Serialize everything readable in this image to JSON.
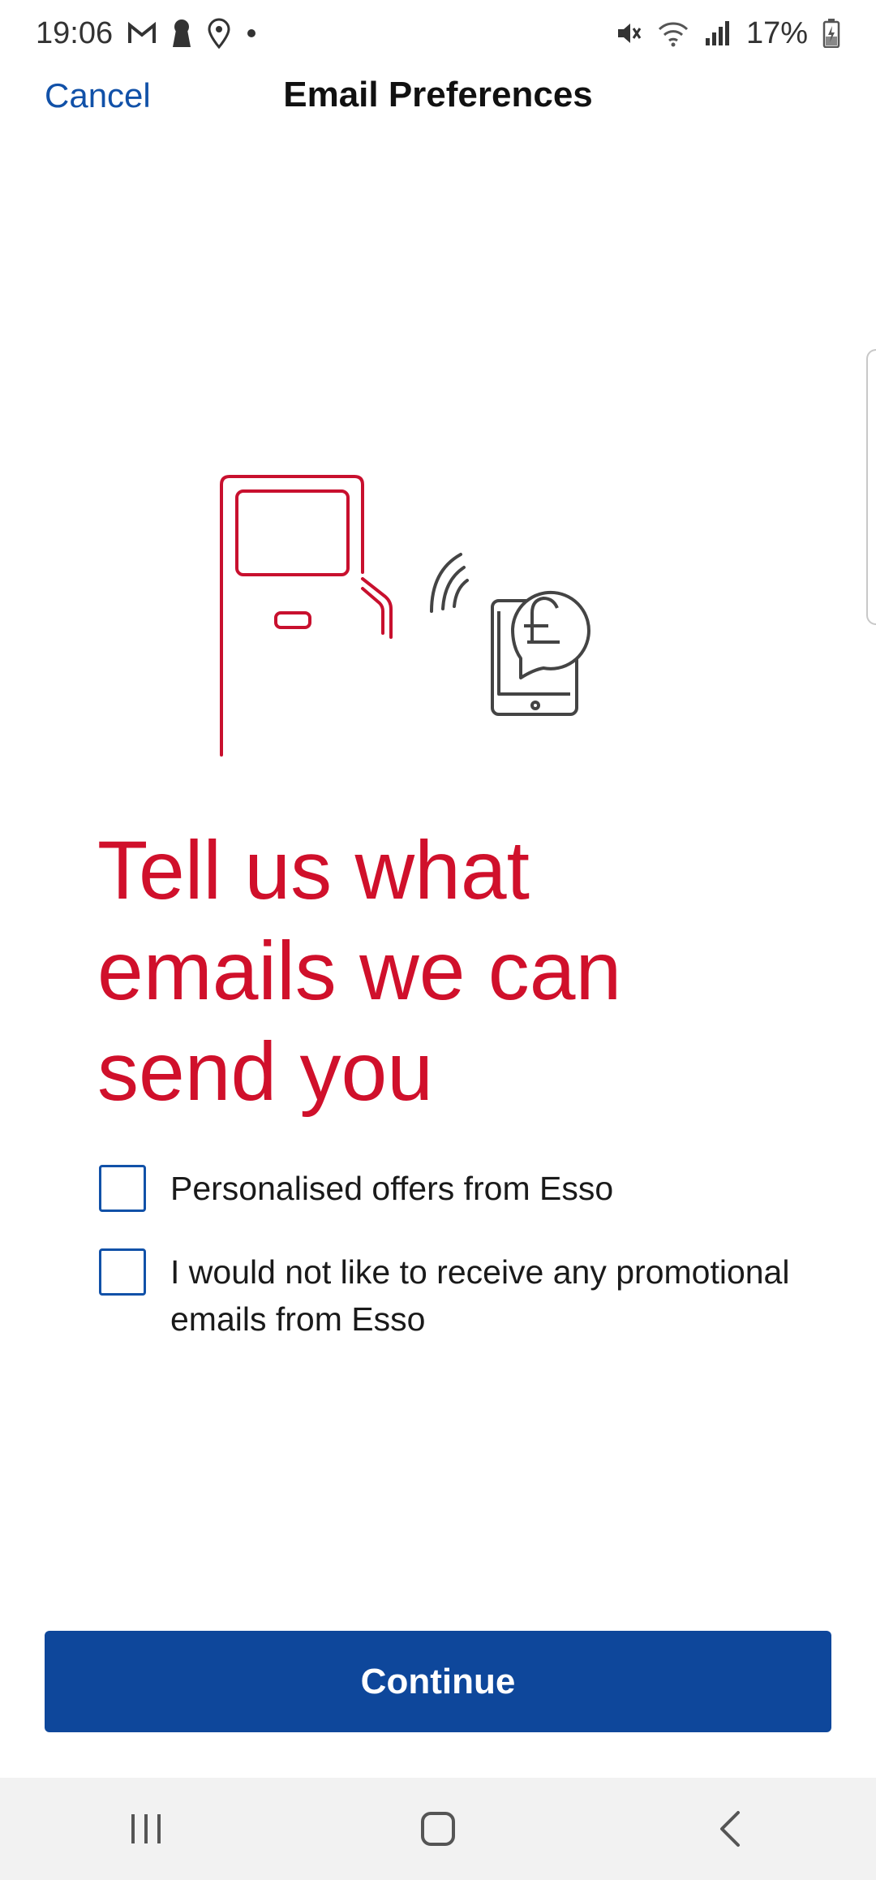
{
  "status_bar": {
    "time": "19:06",
    "battery": "17%",
    "left_icons": [
      "gmail-icon",
      "keyhole-icon",
      "location-icon",
      "dot-icon"
    ],
    "right_icons": [
      "mute-icon",
      "wifi-icon",
      "signal-icon",
      "battery-icon"
    ]
  },
  "header": {
    "cancel_label": "Cancel",
    "title": "Email Preferences"
  },
  "illustration": {
    "icons": [
      "fuel-pump-icon",
      "contactless-icon",
      "phone-pound-icon"
    ],
    "colors": {
      "pump": "#c8102e",
      "phone": "#444444"
    }
  },
  "main": {
    "heading_lines": [
      "Tell us what",
      "emails we can",
      "send you"
    ],
    "options": [
      {
        "label": "Personalised offers from Esso",
        "checked": false
      },
      {
        "label": "I would not like to receive any promotional emails from Esso",
        "checked": false
      }
    ],
    "continue_label": "Continue"
  },
  "nav_bar": {
    "buttons": [
      "recent-apps-icon",
      "home-icon",
      "back-icon"
    ]
  },
  "colors": {
    "accent_blue": "#0e479b",
    "link_blue": "#1151a8",
    "heading_red": "#d0102b"
  }
}
